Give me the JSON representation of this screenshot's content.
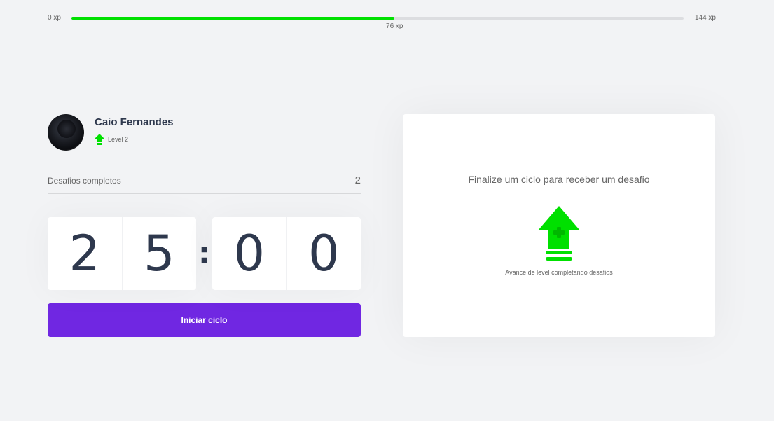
{
  "xp": {
    "min_label": "0 xp",
    "max_label": "144 xp",
    "current_label": "76 xp",
    "current": 76,
    "max": 144,
    "fill_color": "#00e000"
  },
  "profile": {
    "name": "Caio Fernandes",
    "level_label": "Level 2",
    "level_icon": "level-up-arrow-icon"
  },
  "challenges": {
    "label": "Desafios completos",
    "count": "2"
  },
  "countdown": {
    "minutes_tens": "2",
    "minutes_ones": "5",
    "separator": ":",
    "seconds_tens": "0",
    "seconds_ones": "0"
  },
  "actions": {
    "start_label": "Iniciar ciclo",
    "start_color": "#7027e2"
  },
  "challenge_card": {
    "title": "Finalize um ciclo para receber um desafio",
    "hint": "Avance de level completando desafios",
    "icon": "level-up-icon"
  }
}
